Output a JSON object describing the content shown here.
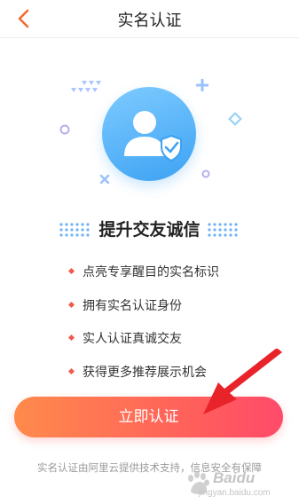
{
  "header": {
    "title": "实名认证",
    "back_icon": "chevron-left-icon"
  },
  "illustration": {
    "main_icon": "user-shield-icon"
  },
  "slogan": "提升交友诚信",
  "benefits": [
    "点亮专享醒目的实名标识",
    "拥有实名认证身份",
    "实人认证真诚交友",
    "获得更多推荐展示机会"
  ],
  "cta": {
    "label": "立即认证"
  },
  "footnote": "实名认证由阿里云提供技术支持，信息安全有保障",
  "watermark": {
    "brand": "Baidu",
    "sub": "jingyan.baidu.com"
  },
  "colors": {
    "accent": "#f26b2e",
    "button_start": "#ff8a4c",
    "button_end": "#ff4a6a",
    "icon_blue": "#3da2f3",
    "bullet": "#f25a4d",
    "arrow": "#e8242a"
  }
}
